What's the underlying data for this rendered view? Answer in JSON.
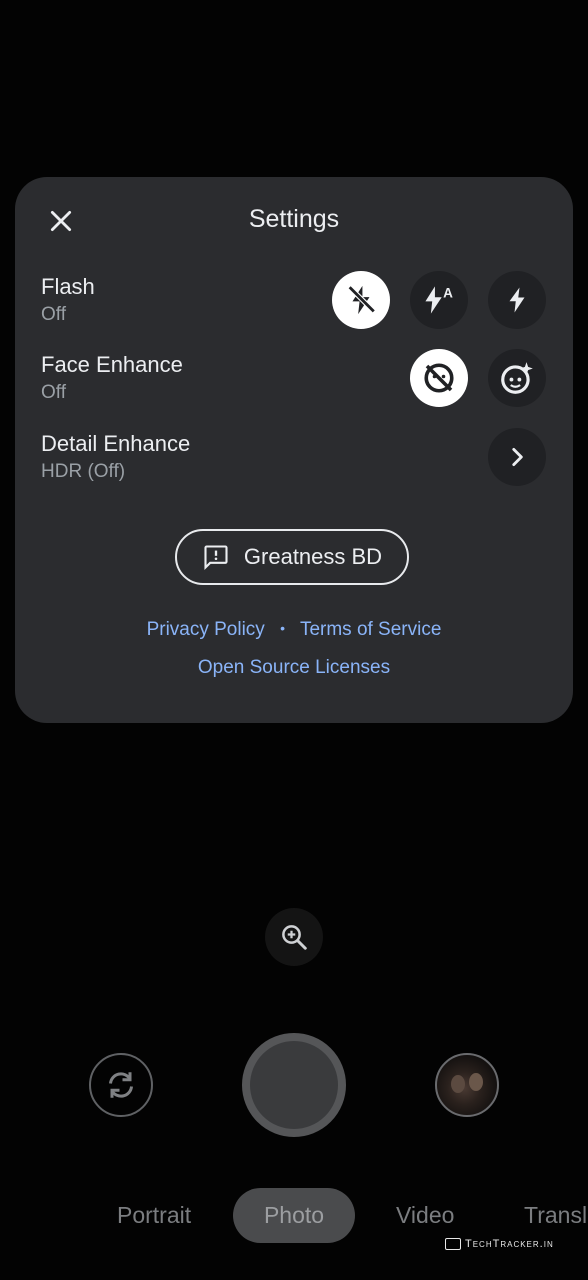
{
  "settings": {
    "title": "Settings",
    "flash": {
      "label": "Flash",
      "value": "Off",
      "options": [
        "flash-off-icon",
        "flash-auto-icon",
        "flash-on-icon"
      ],
      "selected": "flash-off-icon"
    },
    "face_enhance": {
      "label": "Face Enhance",
      "value": "Off",
      "options": [
        "face-enhance-off-icon",
        "face-enhance-on-icon"
      ],
      "selected": "face-enhance-off-icon"
    },
    "detail_enhance": {
      "label": "Detail Enhance",
      "value": "HDR (Off)"
    },
    "feedback_label": "Greatness BD",
    "links": {
      "privacy": "Privacy Policy",
      "separator": "•",
      "terms": "Terms of Service",
      "licenses": "Open Source Licenses"
    }
  },
  "camera": {
    "modes": [
      "Portrait",
      "Photo",
      "Video",
      "Transla"
    ],
    "active_mode": "Photo"
  },
  "watermark": {
    "text": "TechTracker.in"
  },
  "colors": {
    "panel_bg": "#2b2c2f",
    "link": "#8ab4f8",
    "selected_btn": "#ffffff"
  }
}
